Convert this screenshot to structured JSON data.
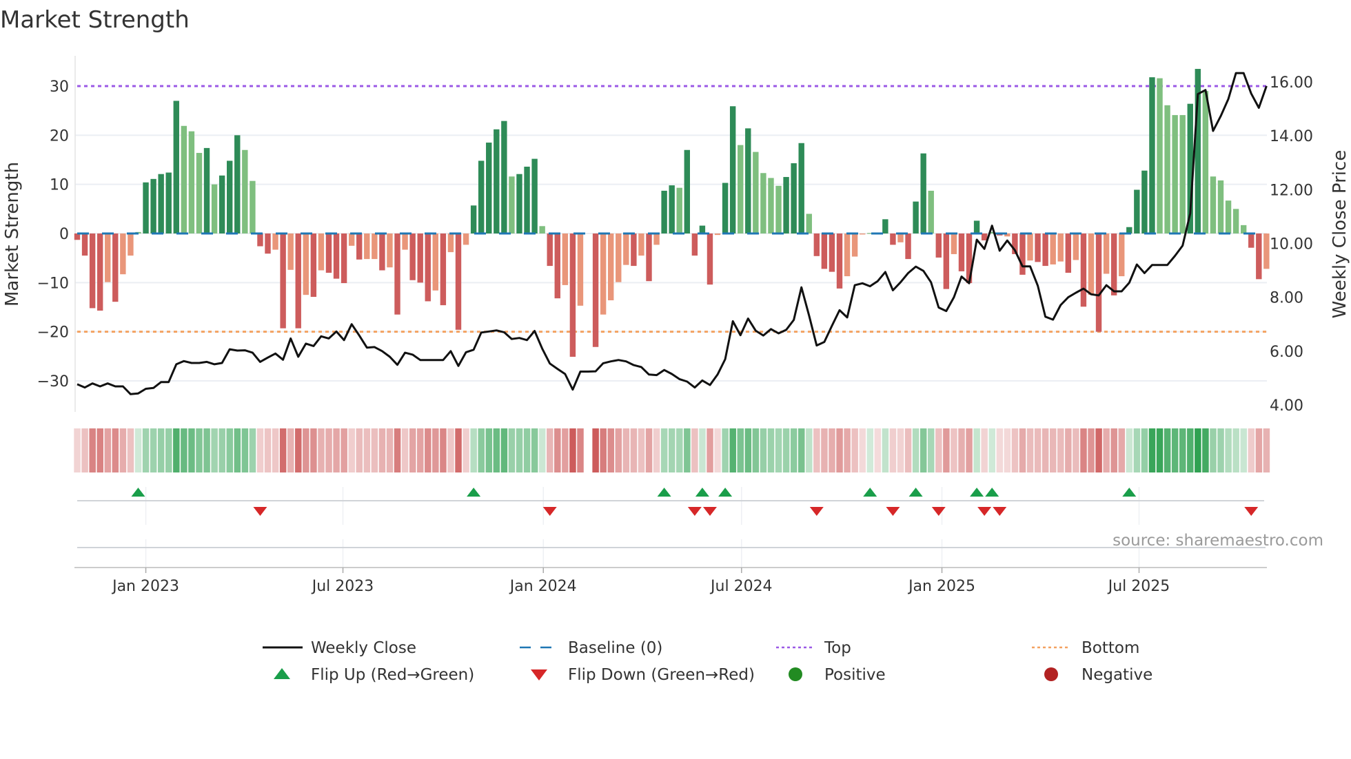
{
  "chart_data": {
    "type": "bar",
    "title": "Market Strength",
    "source_note": "source: sharemaestro.com",
    "x_start": "2022-10-30",
    "x_step_days": 7,
    "x_ticks": [
      {
        "date": "2023-01-01",
        "label": "Jan 2023"
      },
      {
        "date": "2023-07-01",
        "label": "Jul 2023"
      },
      {
        "date": "2024-01-01",
        "label": "Jan 2024"
      },
      {
        "date": "2024-07-01",
        "label": "Jul 2024"
      },
      {
        "date": "2025-01-01",
        "label": "Jan 2025"
      },
      {
        "date": "2025-07-01",
        "label": "Jul 2025"
      }
    ],
    "y_left": {
      "label": "Market Strength",
      "range": [
        -36,
        37
      ],
      "ticks": [
        30,
        20,
        10,
        0,
        -10,
        -20,
        -30
      ],
      "tick_labels": [
        "30",
        "20",
        "10",
        "0",
        "−10",
        "−20",
        "−30"
      ]
    },
    "y_right": {
      "label": "Weekly Close Price",
      "range": [
        3.3,
        17.9
      ],
      "ticks": [
        16,
        14,
        12,
        10,
        8,
        6,
        4
      ],
      "tick_labels": [
        "16.00",
        "14.00",
        "12.00",
        "10.00",
        "8.00",
        "6.00",
        "4.00"
      ]
    },
    "reference_lines": {
      "top": 30,
      "bottom": -20,
      "baseline": 0
    },
    "strength": [
      -1.3,
      -4.5,
      -15.2,
      -15.7,
      -9.9,
      -13.9,
      -8.3,
      -4.5,
      0.3,
      10.4,
      11.1,
      12.1,
      12.4,
      27.0,
      21.9,
      20.8,
      16.4,
      17.4,
      10.0,
      11.8,
      14.8,
      20.0,
      17.0,
      10.7,
      -2.6,
      -4.1,
      -3.3,
      -19.3,
      -7.4,
      -19.3,
      -12.5,
      -12.9,
      -7.5,
      -8.0,
      -9.2,
      -10.1,
      -2.5,
      -5.3,
      -5.2,
      -5.2,
      -7.5,
      -6.9,
      -16.5,
      -3.3,
      -9.5,
      -10.0,
      -13.8,
      -11.6,
      -14.6,
      -3.8,
      -19.6,
      -2.3,
      5.7,
      14.8,
      18.5,
      21.2,
      22.9,
      11.6,
      12.1,
      13.6,
      15.2,
      1.5,
      -6.6,
      -13.2,
      -10.5,
      -25.1,
      -14.7,
      0,
      -23.1,
      -16.5,
      -13.6,
      -9.9,
      -6.4,
      -6.6,
      -4.5,
      -9.7,
      -2.3,
      8.7,
      9.8,
      9.3,
      17.0,
      -4.5,
      1.6,
      -10.4,
      -0.3,
      10.3,
      25.9,
      18.0,
      21.4,
      16.6,
      12.3,
      11.3,
      9.7,
      11.5,
      14.3,
      18.4,
      4.0,
      -4.6,
      -7.2,
      -7.8,
      -11.2,
      -8.7,
      -4.7,
      -0.2,
      0.1,
      -0.1,
      2.9,
      -2.3,
      -1.8,
      -5.2,
      6.5,
      16.3,
      8.7,
      -4.9,
      -11.3,
      -4.2,
      -7.7,
      -10.1,
      2.6,
      -1.4,
      0.3,
      -0.4,
      -0.6,
      -4.2,
      -8.4,
      -5.5,
      -5.8,
      -6.6,
      -6.3,
      -5.7,
      -8.0,
      -5.4,
      -14.9,
      -12.5,
      -20.0,
      -8.2,
      -12.6,
      -8.7,
      1.3,
      8.9,
      12.8,
      31.8,
      31.6,
      26.1,
      24.1,
      24.1,
      26.4,
      33.5,
      29.0,
      11.6,
      10.8,
      6.7,
      5.0,
      1.7,
      -2.9,
      -9.3,
      -7.2
    ],
    "strength_shade": [
      "d",
      "d",
      "d",
      "d",
      "l",
      "d",
      "l",
      "l",
      "l",
      "d",
      "d",
      "d",
      "d",
      "d",
      "l",
      "l",
      "l",
      "d",
      "l",
      "d",
      "d",
      "d",
      "l",
      "l",
      "d",
      "d",
      "l",
      "d",
      "l",
      "d",
      "l",
      "d",
      "l",
      "d",
      "d",
      "d",
      "l",
      "d",
      "l",
      "l",
      "d",
      "l",
      "d",
      "l",
      "d",
      "d",
      "d",
      "l",
      "d",
      "l",
      "d",
      "l",
      "d",
      "d",
      "d",
      "d",
      "d",
      "l",
      "d",
      "d",
      "d",
      "l",
      "d",
      "d",
      "l",
      "d",
      "l",
      "l",
      "d",
      "l",
      "l",
      "l",
      "l",
      "d",
      "l",
      "d",
      "l",
      "d",
      "d",
      "l",
      "d",
      "d",
      "d",
      "d",
      "l",
      "d",
      "d",
      "l",
      "d",
      "l",
      "l",
      "l",
      "l",
      "d",
      "d",
      "d",
      "l",
      "d",
      "d",
      "d",
      "d",
      "l",
      "l",
      "l",
      "l",
      "l",
      "d",
      "d",
      "l",
      "d",
      "d",
      "d",
      "l",
      "d",
      "d",
      "l",
      "d",
      "d",
      "d",
      "d",
      "l",
      "d",
      "l",
      "d",
      "d",
      "l",
      "d",
      "d",
      "l",
      "l",
      "d",
      "l",
      "d",
      "l",
      "d",
      "l",
      "d",
      "l",
      "d",
      "d",
      "d",
      "d",
      "l",
      "l",
      "l",
      "l",
      "d",
      "d",
      "l",
      "l",
      "l",
      "l",
      "l",
      "l",
      "d",
      "d",
      "l"
    ],
    "weekly_close": [
      4.77,
      4.65,
      4.8,
      4.69,
      4.8,
      4.69,
      4.69,
      4.4,
      4.43,
      4.6,
      4.63,
      4.85,
      4.85,
      5.51,
      5.63,
      5.56,
      5.56,
      5.6,
      5.51,
      5.56,
      6.07,
      6.02,
      6.03,
      5.94,
      5.6,
      5.76,
      5.91,
      5.68,
      6.47,
      5.79,
      6.28,
      6.19,
      6.55,
      6.47,
      6.73,
      6.41,
      7.0,
      6.58,
      6.13,
      6.15,
      6.0,
      5.79,
      5.49,
      5.94,
      5.87,
      5.67,
      5.67,
      5.67,
      5.67,
      6.0,
      5.45,
      5.96,
      6.05,
      6.69,
      6.73,
      6.77,
      6.7,
      6.45,
      6.49,
      6.41,
      6.75,
      6.09,
      5.54,
      5.34,
      5.15,
      4.57,
      5.24,
      5.24,
      5.25,
      5.55,
      5.62,
      5.67,
      5.62,
      5.48,
      5.41,
      5.13,
      5.11,
      5.3,
      5.15,
      4.96,
      4.87,
      4.65,
      4.91,
      4.74,
      5.13,
      5.7,
      7.11,
      6.59,
      7.21,
      6.76,
      6.58,
      6.82,
      6.66,
      6.79,
      7.16,
      8.37,
      7.32,
      6.21,
      6.34,
      6.94,
      7.52,
      7.25,
      8.45,
      8.52,
      8.41,
      8.6,
      8.94,
      8.26,
      8.56,
      8.9,
      9.14,
      8.98,
      8.56,
      7.62,
      7.49,
      8.0,
      8.77,
      8.52,
      10.14,
      9.8,
      10.66,
      9.73,
      10.11,
      9.75,
      9.15,
      9.15,
      8.43,
      7.28,
      7.17,
      7.71,
      8.0,
      8.17,
      8.32,
      8.11,
      8.07,
      8.45,
      8.22,
      8.22,
      8.54,
      9.22,
      8.9,
      9.2,
      9.2,
      9.2,
      9.54,
      9.92,
      11.12,
      15.55,
      15.7,
      14.18,
      14.73,
      15.37,
      16.33,
      16.33,
      15.57,
      15.04,
      15.85
    ],
    "flip_up_index": [
      8,
      52,
      77,
      82,
      85,
      104,
      110,
      118,
      120,
      138
    ],
    "flip_down_index": [
      24,
      62,
      81,
      83,
      97,
      107,
      113,
      119,
      121,
      154
    ],
    "legend": {
      "placement": "bottom",
      "items": [
        {
          "key": "close",
          "label": "Weekly Close"
        },
        {
          "key": "baseline",
          "label": "Baseline (0)"
        },
        {
          "key": "top",
          "label": "Top"
        },
        {
          "key": "bottom",
          "label": "Bottom"
        },
        {
          "key": "flip_up",
          "label": "Flip Up (Red→Green)"
        },
        {
          "key": "flip_down",
          "label": "Flip Down (Green→Red)"
        },
        {
          "key": "positive",
          "label": "Positive"
        },
        {
          "key": "negative",
          "label": "Negative"
        }
      ]
    },
    "colors": {
      "pos_strong": "#2e8b57",
      "pos_weak": "#7fbf7f",
      "neg_strong": "#cd5c5c",
      "neg_weak": "#e9967a",
      "close": "#111111",
      "baseline": "#1f77b4",
      "top": "#9b59e6",
      "bottom": "#f4a261",
      "flip_up": "#1a9e4a",
      "flip_down": "#d62728",
      "positive": "#228b22",
      "negative": "#b22222"
    }
  }
}
